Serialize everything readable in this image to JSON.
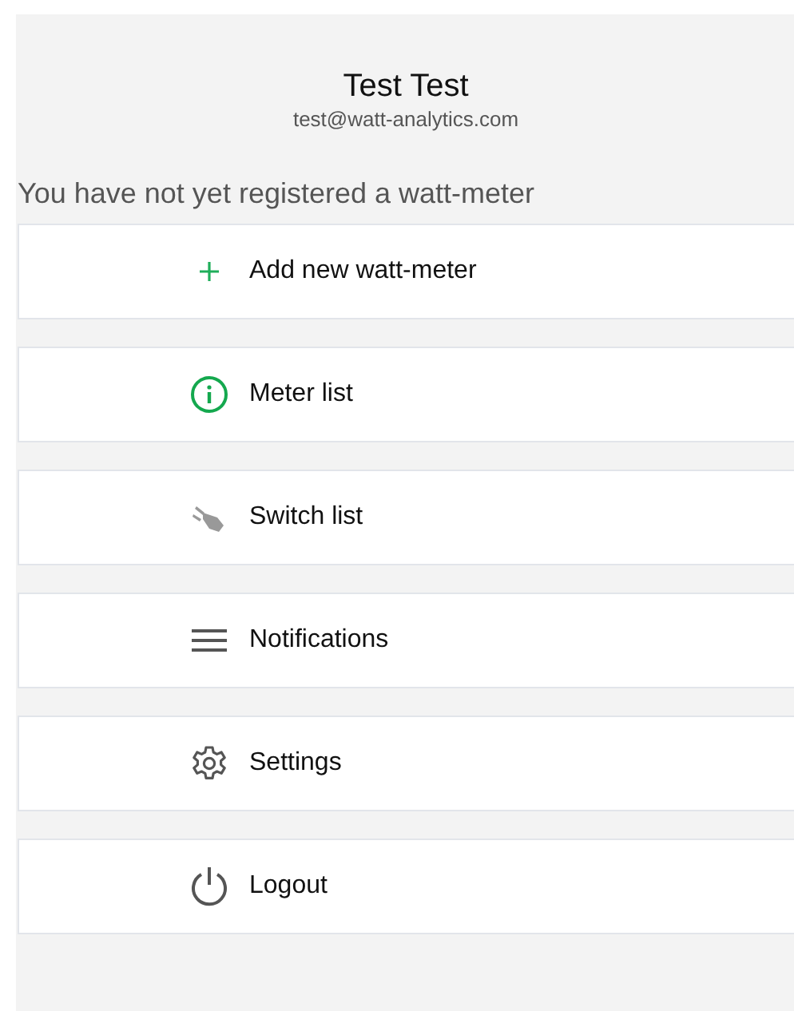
{
  "profile": {
    "name": "Test Test",
    "email": "test@watt-analytics.com"
  },
  "notice": "You have not yet registered a watt-meter",
  "menu": [
    {
      "kind": "add",
      "label": "Add new watt-meter"
    },
    {
      "kind": "info",
      "label": "Meter list"
    },
    {
      "kind": "plug",
      "label": "Switch list"
    },
    {
      "kind": "lines",
      "label": "Notifications"
    },
    {
      "kind": "gear",
      "label": "Settings"
    },
    {
      "kind": "power",
      "label": "Logout"
    }
  ]
}
